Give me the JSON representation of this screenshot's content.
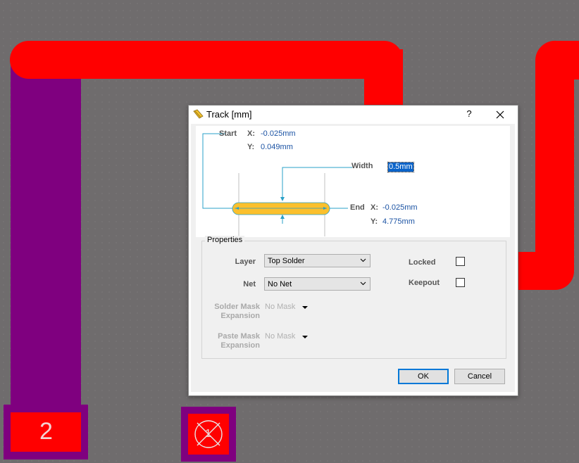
{
  "canvas": {
    "pads": [
      {
        "label": "2"
      },
      {
        "label": "1"
      }
    ],
    "colors": {
      "background": "#6f6c6d",
      "track_red": "#ff0000",
      "track_purple": "#7f007f"
    }
  },
  "dialog": {
    "title": "Track [mm]",
    "help_label": "?",
    "close_label": "✕",
    "start": {
      "label": "Start",
      "x_label": "X:",
      "x_value": "-0.025mm",
      "y_label": "Y:",
      "y_value": "0.049mm"
    },
    "width": {
      "label": "Width",
      "value": "0.5mm"
    },
    "end": {
      "label": "End",
      "x_label": "X:",
      "x_value": "-0.025mm",
      "y_label": "Y:",
      "y_value": "4.775mm"
    },
    "properties": {
      "title": "Properties",
      "layer": {
        "label": "Layer",
        "value": "Top Solder"
      },
      "net": {
        "label": "Net",
        "value": "No Net"
      },
      "solder_mask": {
        "label_line1": "Solder Mask",
        "label_line2": "Expansion",
        "value": "No Mask"
      },
      "paste_mask": {
        "label_line1": "Paste Mask",
        "label_line2": "Expansion",
        "value": "No Mask"
      },
      "locked": {
        "label": "Locked",
        "checked": false
      },
      "keepout": {
        "label": "Keepout",
        "checked": false
      }
    },
    "ok_label": "OK",
    "cancel_label": "Cancel",
    "colors": {
      "value_text": "#1a52a3",
      "track_preview": "#fbc02d",
      "dimension_lines": "#2aa0c8"
    }
  }
}
